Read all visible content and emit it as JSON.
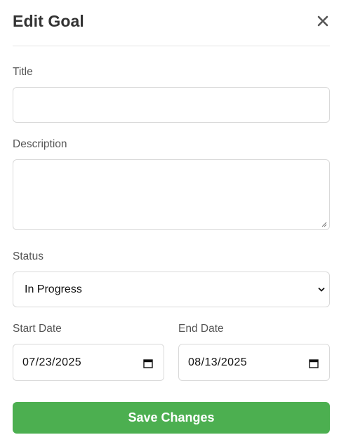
{
  "modal": {
    "title": "Edit Goal",
    "close_icon": "close-icon"
  },
  "form": {
    "title_label": "Title",
    "title_value": "",
    "description_label": "Description",
    "description_value": "",
    "status_label": "Status",
    "status_value": "In Progress",
    "start_date_label": "Start Date",
    "start_date_value": "07/23/2025",
    "end_date_label": "End Date",
    "end_date_value": "08/13/2025",
    "calendar_icon": "calendar-icon",
    "chevron_icon": "chevron-down-icon"
  },
  "actions": {
    "save_label": "Save Changes"
  },
  "colors": {
    "accent": "#4caf50",
    "title_text": "#333333",
    "label_text": "#555555",
    "border": "#d9d9d9"
  }
}
